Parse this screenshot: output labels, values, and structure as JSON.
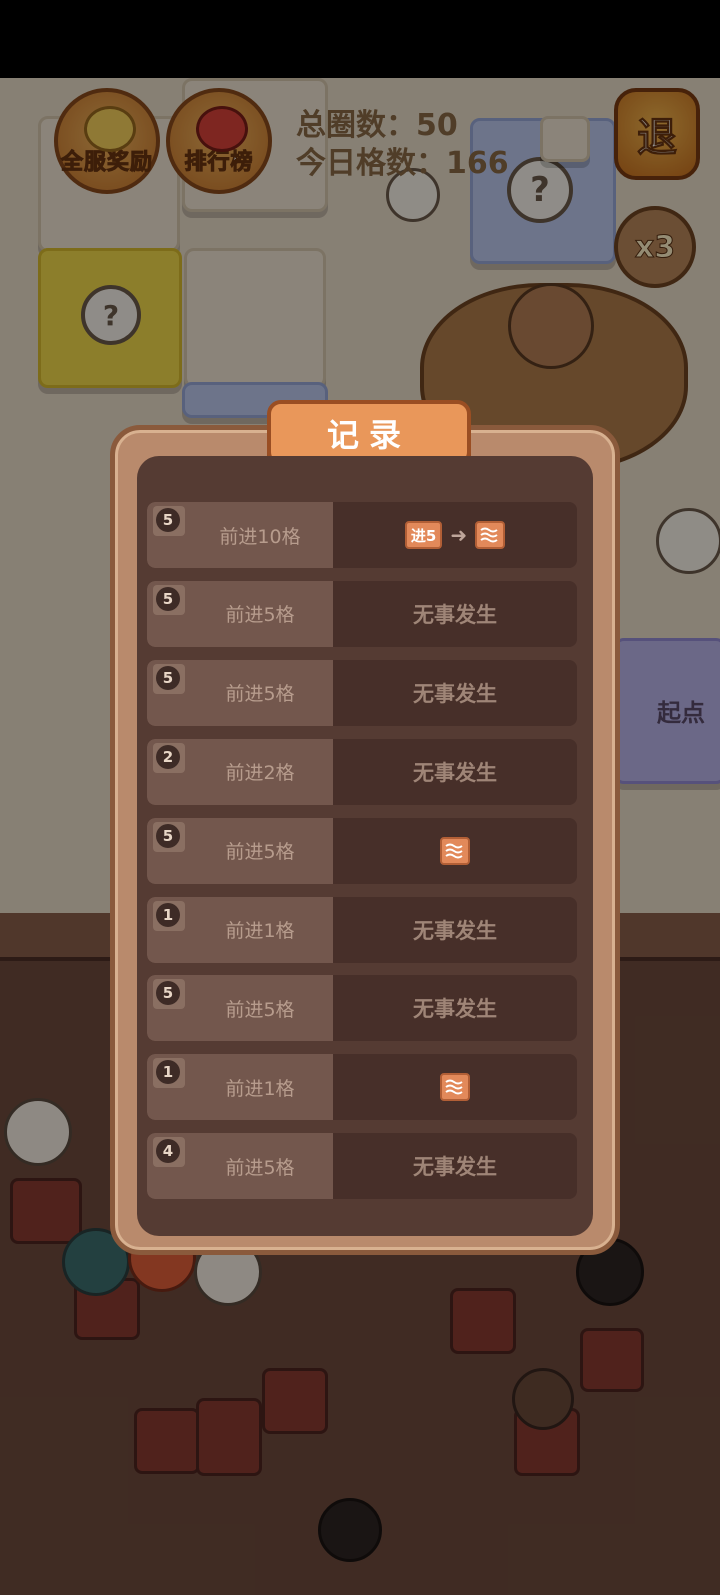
{
  "hud": {
    "server_reward_label": "全服奖励",
    "ranking_label": "排行榜",
    "total_laps_label": "总圈数：",
    "total_laps_value": "50",
    "today_cells_label": "今日格数：",
    "today_cells_value": "166",
    "exit_label": "退",
    "multiplier_label": "x3",
    "start_tile_label": "起点",
    "help_label": "?"
  },
  "record_dialog": {
    "title": "记录",
    "rows": [
      {
        "dice": "5",
        "action": "前进10格",
        "result_type": "combo",
        "badge_text": "进5"
      },
      {
        "dice": "5",
        "action": "前进5格",
        "result_type": "text",
        "result": "无事发生"
      },
      {
        "dice": "5",
        "action": "前进5格",
        "result_type": "text",
        "result": "无事发生"
      },
      {
        "dice": "2",
        "action": "前进2格",
        "result_type": "text",
        "result": "无事发生"
      },
      {
        "dice": "5",
        "action": "前进5格",
        "result_type": "icon"
      },
      {
        "dice": "1",
        "action": "前进1格",
        "result_type": "text",
        "result": "无事发生"
      },
      {
        "dice": "5",
        "action": "前进5格",
        "result_type": "text",
        "result": "无事发生"
      },
      {
        "dice": "1",
        "action": "前进1格",
        "result_type": "icon"
      },
      {
        "dice": "4",
        "action": "前进5格",
        "result_type": "text",
        "result": "无事发生"
      }
    ]
  },
  "colors": {
    "modal_frame": "#b98a6c",
    "modal_inner": "#553b33",
    "title_bg": "#e9975a",
    "badge_bg": "#e2895a"
  }
}
